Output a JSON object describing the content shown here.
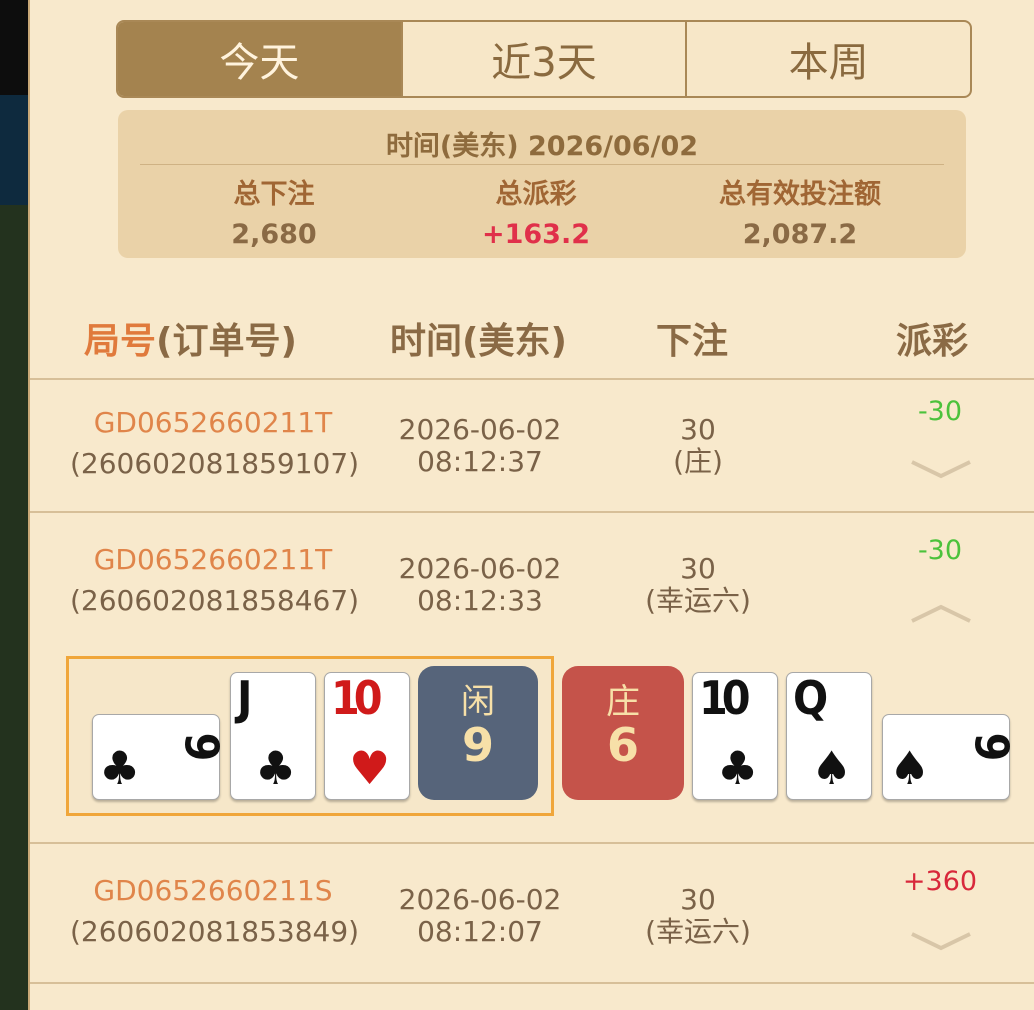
{
  "tabs": [
    {
      "label": "今天",
      "active": true
    },
    {
      "label": "近3天",
      "active": false
    },
    {
      "label": "本周",
      "active": false
    }
  ],
  "summary": {
    "date_line": "时间(美东) 2026/06/02",
    "total_bet_label": "总下注",
    "total_bet_value": "2,680",
    "total_payout_label": "总派彩",
    "total_payout_value": "+163.2",
    "valid_bet_label": "总有效投注额",
    "valid_bet_value": "2,087.2"
  },
  "columns": {
    "order_accent": "局号",
    "order_rest": "(订单号)",
    "time": "时间(美东)",
    "bet": "下注",
    "payout": "派彩"
  },
  "rows": [
    {
      "round_id": "GD0652660211T",
      "order_no": "(260602081859107)",
      "date": "2026-06-02",
      "time": "08:12:37",
      "bet_amount": "30",
      "bet_type": "(庄)",
      "payout": "-30",
      "expanded": false
    },
    {
      "round_id": "GD0652660211T",
      "order_no": "(260602081858467)",
      "date": "2026-06-02",
      "time": "08:12:33",
      "bet_amount": "30",
      "bet_type": "(幸运六)",
      "payout": "-30",
      "expanded": true
    },
    {
      "round_id": "GD0652660211S",
      "order_no": "(260602081853849)",
      "date": "2026-06-02",
      "time": "08:12:07",
      "bet_amount": "30",
      "bet_type": "(幸运六)",
      "payout": "+360",
      "expanded": false
    }
  ],
  "hand": {
    "player_label": "闲",
    "player_score": "9",
    "banker_label": "庄",
    "banker_score": "6",
    "player_cards": [
      {
        "rank": "9",
        "suit": "♣",
        "color": "black"
      },
      {
        "rank": "J",
        "suit": "♣",
        "color": "black"
      },
      {
        "rank": "10",
        "suit": "♥",
        "color": "red"
      }
    ],
    "banker_cards": [
      {
        "rank": "10",
        "suit": "♣",
        "color": "black"
      },
      {
        "rank": "Q",
        "suit": "♠",
        "color": "black"
      },
      {
        "rank": "9",
        "suit": "♠",
        "color": "black"
      }
    ]
  },
  "colors": {
    "accent": "#a4834f",
    "positive": "#d8283b",
    "negative": "#4cc23c",
    "player_box": "#56647a",
    "banker_box": "#c5534a"
  }
}
